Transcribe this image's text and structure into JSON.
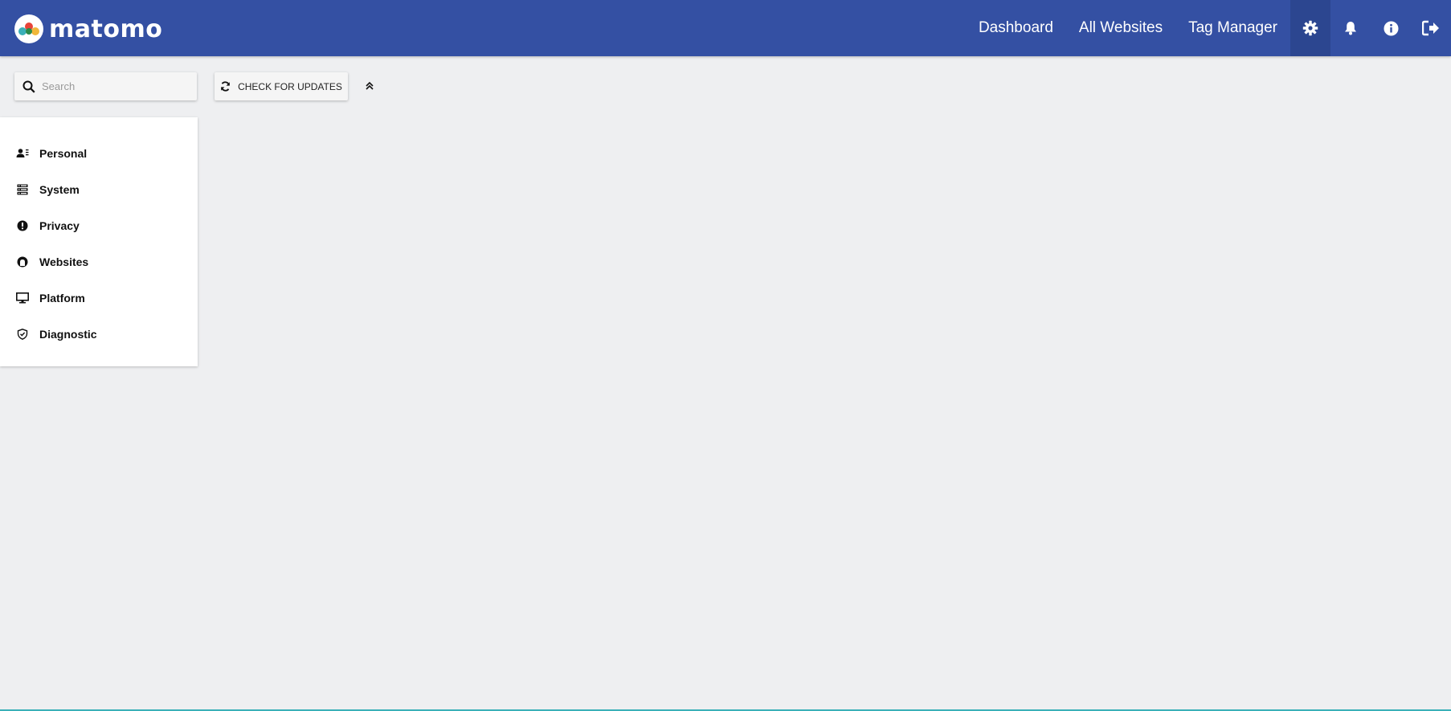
{
  "header": {
    "logo_text": "matomo",
    "nav": [
      {
        "label": "Dashboard"
      },
      {
        "label": "All Websites"
      },
      {
        "label": "Tag Manager"
      }
    ],
    "icons": [
      "gear-icon",
      "bell-icon",
      "info-icon",
      "logout-icon"
    ],
    "background_color": "#3450a3",
    "active_icon_background": "#2c4690"
  },
  "toolbar": {
    "search_placeholder": "Search",
    "check_updates_label": "CHECK FOR UPDATES"
  },
  "sidebar": {
    "items": [
      {
        "label": "Personal",
        "icon": "user-list-icon"
      },
      {
        "label": "System",
        "icon": "server-icon"
      },
      {
        "label": "Privacy",
        "icon": "privacy-icon"
      },
      {
        "label": "Websites",
        "icon": "websites-icon"
      },
      {
        "label": "Platform",
        "icon": "monitor-icon"
      },
      {
        "label": "Diagnostic",
        "icon": "shield-icon"
      }
    ]
  }
}
